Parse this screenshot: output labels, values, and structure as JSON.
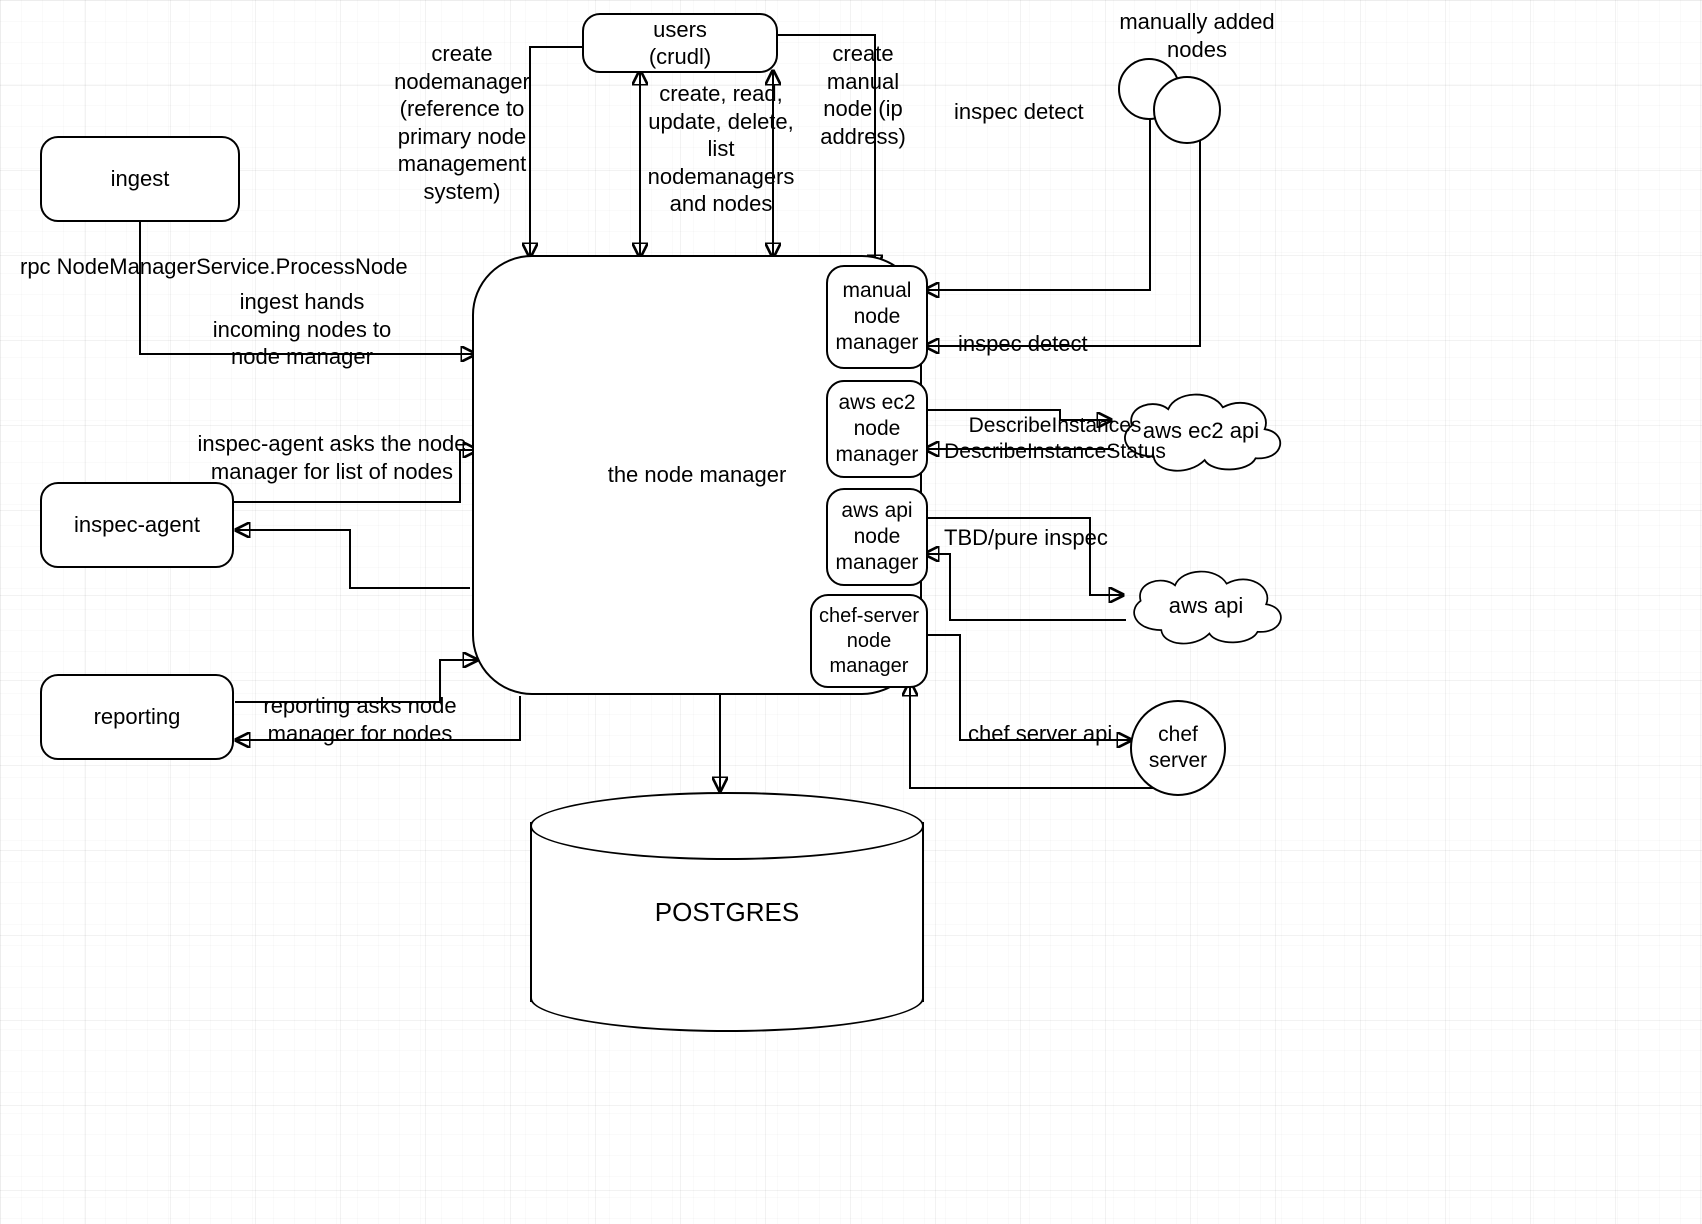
{
  "nodes": {
    "users": "users\n(crudl)",
    "ingest": "ingest",
    "inspec_agent": "inspec-agent",
    "reporting": "reporting",
    "node_manager": "the node manager",
    "manual_mgr": "manual\nnode\nmanager",
    "aws_ec2_mgr": "aws ec2\nnode\nmanager",
    "aws_api_mgr": "aws api\nnode\nmanager",
    "chef_server_mgr": "chef-server\nnode\nmanager",
    "manual_nodes": "manually added\nnodes",
    "aws_ec2_api": "aws ec2 api",
    "aws_api": "aws api",
    "chef_server": "chef\nserver",
    "postgres": "POSTGRES"
  },
  "labels": {
    "create_nodemgr": "create\nnodemanager\n(reference to\nprimary node\nmanagement\nsystem)",
    "crud_nodemgrs": "create, read,\nupdate, delete,\nlist\nnodemanagers\nand nodes",
    "create_manual": "create\nmanual\nnode (ip\naddress)",
    "rpc": "rpc NodeManagerService.ProcessNode",
    "ingest_hands": "ingest hands\nincoming nodes to\nnode manager",
    "inspec_asks": "inspec-agent asks the node\nmanager for list of nodes",
    "reporting_asks": "reporting asks node\nmanager for nodes",
    "inspec_detect": "inspec detect",
    "inspec_detect2": "inspec detect",
    "describe": "DescribeInstances\nDescribeInstanceStatus",
    "tbd_inspec": "TBD/pure inspec",
    "chef_api": "chef server api"
  }
}
